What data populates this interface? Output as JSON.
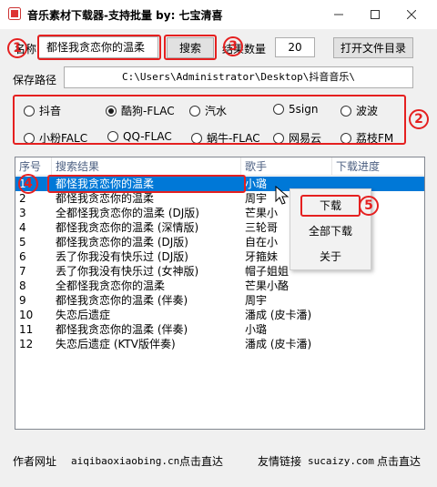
{
  "window": {
    "title": "音乐素材下载器-支持批量    by:  七宝清喜"
  },
  "search": {
    "label": "名称",
    "value": "都怪我贪恋你的温柔",
    "button": "搜索"
  },
  "count": {
    "label": "结果数量",
    "value": "20"
  },
  "open_dir_button": "打开文件目录",
  "save_path": {
    "label": "保存路径",
    "value": "C:\\Users\\Administrator\\Desktop\\抖音音乐\\"
  },
  "sources": [
    {
      "label": "抖音",
      "selected": false
    },
    {
      "label": "酷狗-FLAC",
      "selected": true
    },
    {
      "label": "汽水",
      "selected": false
    },
    {
      "label": "5sign",
      "selected": false
    },
    {
      "label": "波波",
      "selected": false
    },
    {
      "label": "小粉FALC",
      "selected": false
    },
    {
      "label": "QQ-FLAC",
      "selected": false
    },
    {
      "label": "蜗牛-FLAC",
      "selected": false
    },
    {
      "label": "网易云",
      "selected": false
    },
    {
      "label": "荔枝FM",
      "selected": false
    }
  ],
  "table": {
    "columns": [
      "序号",
      "搜索结果",
      "歌手",
      "下载进度"
    ],
    "rows": [
      {
        "no": "1",
        "song": "都怪我贪恋你的温柔",
        "singer": "小璐"
      },
      {
        "no": "2",
        "song": "都怪我贪恋你的温柔",
        "singer": "周宇"
      },
      {
        "no": "3",
        "song": "全都怪我贪恋你的温柔 (DJ版)",
        "singer": "芒果小"
      },
      {
        "no": "4",
        "song": "都怪我贪恋你的温柔 (深情版)",
        "singer": "三轮哥"
      },
      {
        "no": "5",
        "song": "都怪我贪恋你的温柔 (DJ版)",
        "singer": "自在小"
      },
      {
        "no": "6",
        "song": "丢了你我没有快乐过 (DJ版)",
        "singer": "牙箍妹"
      },
      {
        "no": "7",
        "song": "丢了你我没有快乐过 (女神版)",
        "singer": "帽子姐姐"
      },
      {
        "no": "8",
        "song": "全都怪我贪恋你的温柔",
        "singer": "芒果小酪"
      },
      {
        "no": "9",
        "song": "都怪我贪恋你的温柔 (伴奏)",
        "singer": "周宇"
      },
      {
        "no": "10",
        "song": "失恋后遗症",
        "singer": "潘成 (皮卡潘)"
      },
      {
        "no": "11",
        "song": "都怪我贪恋你的温柔 (伴奏)",
        "singer": "小璐"
      },
      {
        "no": "12",
        "song": "失恋后遗症 (KTV版伴奏)",
        "singer": "潘成 (皮卡潘)"
      }
    ]
  },
  "context_menu": {
    "items": [
      "下载",
      "全部下载",
      "关于"
    ]
  },
  "markers": [
    "1",
    "2",
    "3",
    "4",
    "5"
  ],
  "footer": {
    "author_label": "作者网址",
    "author_url": "aiqibaoxiaobing.cn",
    "author_link": "点击直达",
    "friend_label": "友情链接",
    "friend_url": "sucaizy.com",
    "friend_link": "点击直达"
  },
  "colors": {
    "selection": "#0078d7",
    "annotation": "#e52020",
    "header_text": "#4d6082"
  }
}
